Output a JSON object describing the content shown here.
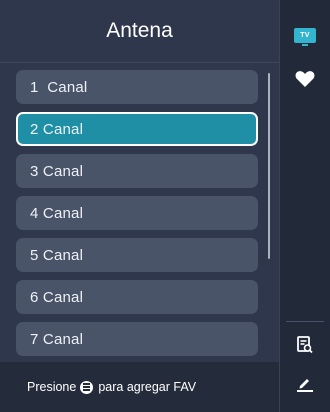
{
  "header": {
    "title": "Antena"
  },
  "channels": [
    {
      "label": "1  Canal",
      "selected": false
    },
    {
      "label": "2 Canal",
      "selected": true
    },
    {
      "label": "3 Canal",
      "selected": false
    },
    {
      "label": "4 Canal",
      "selected": false
    },
    {
      "label": "5 Canal",
      "selected": false
    },
    {
      "label": "6 Canal",
      "selected": false
    },
    {
      "label": "7 Canal",
      "selected": false
    }
  ],
  "footer": {
    "prefix": "Presione",
    "suffix": "para agregar FAV"
  },
  "rail": {
    "tv_badge": "TV",
    "icons": [
      "tv-icon",
      "heart-icon",
      "channel-search-icon",
      "edit-icon"
    ],
    "accent_color": "#33b5cf"
  },
  "colors": {
    "selected_item": "#1f8fa6",
    "item": "#4a5468",
    "panel": "#2e374b"
  }
}
